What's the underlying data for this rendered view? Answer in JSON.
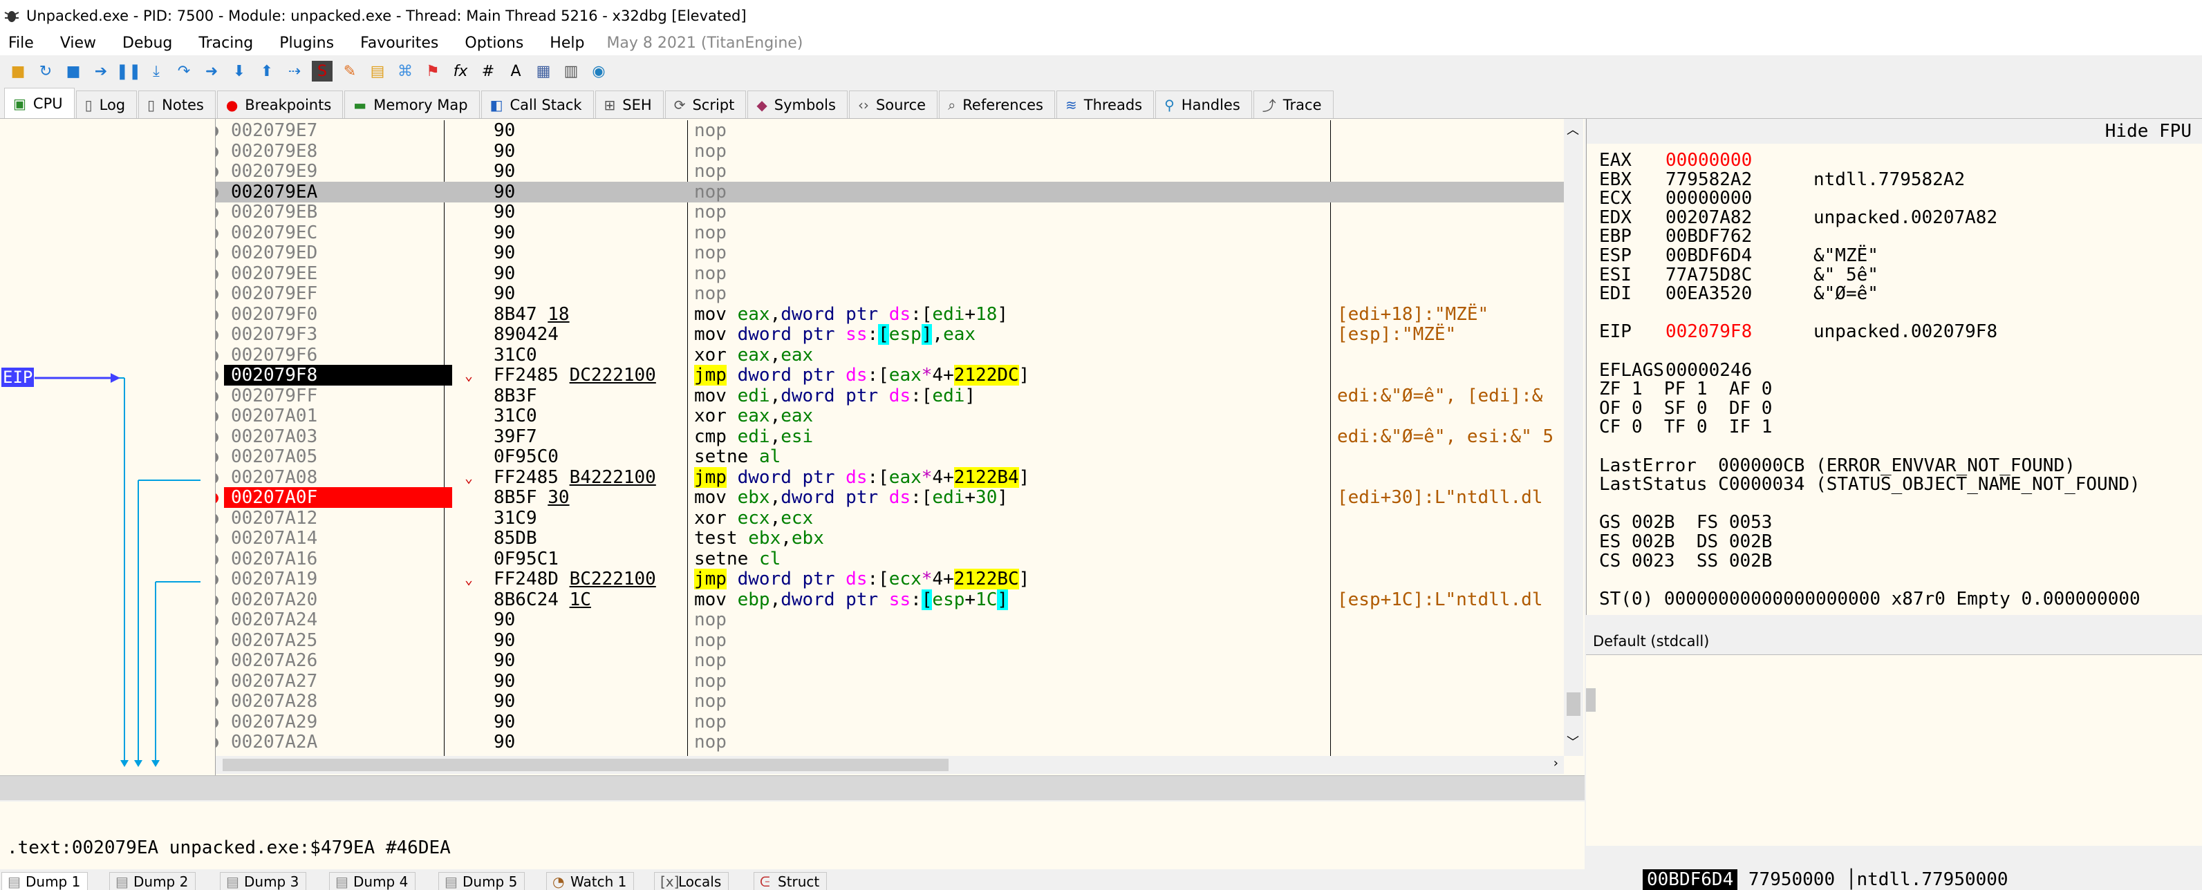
{
  "window": {
    "title": "Unpacked.exe - PID: 7500 - Module: unpacked.exe - Thread: Main Thread 5216 - x32dbg [Elevated]"
  },
  "menu": {
    "items": [
      "File",
      "View",
      "Debug",
      "Tracing",
      "Plugins",
      "Favourites",
      "Options",
      "Help"
    ],
    "date": "May 8 2021 (TitanEngine)"
  },
  "toolbar": {
    "icons": [
      "open-icon",
      "restart-icon",
      "stop-icon",
      "run-icon",
      "pause-icon",
      "step-into-icon",
      "step-over-icon",
      "trace-into-icon",
      "trace-over-icon",
      "execute-till-return-icon",
      "run-to-user-code-icon",
      "scylla-icon",
      "patch-icon",
      "comment-icon",
      "label-icon",
      "bookmark-icon",
      "function-icon",
      "hash-icon",
      "font-icon",
      "settings-icon",
      "calculator-icon",
      "globe-icon"
    ]
  },
  "tabs": [
    {
      "label": "CPU",
      "icon": "cpu-icon",
      "active": true
    },
    {
      "label": "Log",
      "icon": "log-icon"
    },
    {
      "label": "Notes",
      "icon": "notes-icon"
    },
    {
      "label": "Breakpoints",
      "icon": "breakpoint-icon"
    },
    {
      "label": "Memory Map",
      "icon": "memory-icon"
    },
    {
      "label": "Call Stack",
      "icon": "callstack-icon"
    },
    {
      "label": "SEH",
      "icon": "seh-icon"
    },
    {
      "label": "Script",
      "icon": "script-icon"
    },
    {
      "label": "Symbols",
      "icon": "symbols-icon"
    },
    {
      "label": "Source",
      "icon": "source-icon"
    },
    {
      "label": "References",
      "icon": "references-icon"
    },
    {
      "label": "Threads",
      "icon": "threads-icon"
    },
    {
      "label": "Handles",
      "icon": "handles-icon"
    },
    {
      "label": "Trace",
      "icon": "trace-icon"
    }
  ],
  "eip_label": "EIP",
  "disasm": [
    {
      "addr": "002079E7",
      "bytes": "90",
      "asm": "nop"
    },
    {
      "addr": "002079E8",
      "bytes": "90",
      "asm": "nop"
    },
    {
      "addr": "002079E9",
      "bytes": "90",
      "asm": "nop"
    },
    {
      "addr": "002079EA",
      "bytes": "90",
      "asm": "nop",
      "selected": true
    },
    {
      "addr": "002079EB",
      "bytes": "90",
      "asm": "nop"
    },
    {
      "addr": "002079EC",
      "bytes": "90",
      "asm": "nop"
    },
    {
      "addr": "002079ED",
      "bytes": "90",
      "asm": "nop"
    },
    {
      "addr": "002079EE",
      "bytes": "90",
      "asm": "nop"
    },
    {
      "addr": "002079EF",
      "bytes": "90",
      "asm": "nop"
    },
    {
      "addr": "002079F0",
      "bytes": "8B47 18",
      "asm": "mov eax,dword ptr ds:[edi+18]",
      "comment": "[edi+18]:\"MZË\""
    },
    {
      "addr": "002079F3",
      "bytes": "890424",
      "asm": "mov dword ptr ss:[esp],eax",
      "comment": "[esp]:\"MZË\""
    },
    {
      "addr": "002079F6",
      "bytes": "31C0",
      "asm": "xor eax,eax"
    },
    {
      "addr": "002079F8",
      "bytes": "FF2485 DC222100",
      "asm": "jmp dword ptr ds:[eax*4+2122DC]",
      "eip": true
    },
    {
      "addr": "002079FF",
      "bytes": "8B3F",
      "asm": "mov edi,dword ptr ds:[edi]",
      "comment": "edi:&\"Ø=ê\", [edi]:&"
    },
    {
      "addr": "00207A01",
      "bytes": "31C0",
      "asm": "xor eax,eax"
    },
    {
      "addr": "00207A03",
      "bytes": "39F7",
      "asm": "cmp edi,esi",
      "comment": "edi:&\"Ø=ê\", esi:&\" 5"
    },
    {
      "addr": "00207A05",
      "bytes": "0F95C0",
      "asm": "setne al"
    },
    {
      "addr": "00207A08",
      "bytes": "FF2485 B4222100",
      "asm": "jmp dword ptr ds:[eax*4+2122B4]"
    },
    {
      "addr": "00207A0F",
      "bytes": "8B5F 30",
      "asm": "mov ebx,dword ptr ds:[edi+30]",
      "comment": "[edi+30]:L\"ntdll.dl",
      "bp": true
    },
    {
      "addr": "00207A12",
      "bytes": "31C9",
      "asm": "xor ecx,ecx"
    },
    {
      "addr": "00207A14",
      "bytes": "85DB",
      "asm": "test ebx,ebx"
    },
    {
      "addr": "00207A16",
      "bytes": "0F95C1",
      "asm": "setne cl"
    },
    {
      "addr": "00207A19",
      "bytes": "FF248D BC222100",
      "asm": "jmp dword ptr ds:[ecx*4+2122BC]"
    },
    {
      "addr": "00207A20",
      "bytes": "8B6C24 1C",
      "asm": "mov ebp,dword ptr ss:[esp+1C]",
      "comment": "[esp+1C]:L\"ntdll.dl"
    },
    {
      "addr": "00207A24",
      "bytes": "90",
      "asm": "nop"
    },
    {
      "addr": "00207A25",
      "bytes": "90",
      "asm": "nop"
    },
    {
      "addr": "00207A26",
      "bytes": "90",
      "asm": "nop"
    },
    {
      "addr": "00207A27",
      "bytes": "90",
      "asm": "nop"
    },
    {
      "addr": "00207A28",
      "bytes": "90",
      "asm": "nop"
    },
    {
      "addr": "00207A29",
      "bytes": "90",
      "asm": "nop"
    },
    {
      "addr": "00207A2A",
      "bytes": "90",
      "asm": "nop"
    }
  ],
  "info_line": ".text:002079EA unpacked.exe:$479EA #46DEA",
  "registers": {
    "hide_fpu": "Hide FPU",
    "lines": [
      {
        "name": "EAX",
        "value": "00000000",
        "info": "",
        "changed": true
      },
      {
        "name": "EBX",
        "value": "779582A2",
        "info": "ntdll.779582A2"
      },
      {
        "name": "ECX",
        "value": "00000000",
        "info": ""
      },
      {
        "name": "EDX",
        "value": "00207A82",
        "info": "unpacked.00207A82"
      },
      {
        "name": "EBP",
        "value": "00BDF762",
        "info": ""
      },
      {
        "name": "ESP",
        "value": "00BDF6D4",
        "info": "&\"MZË\""
      },
      {
        "name": "ESI",
        "value": "77A75D8C",
        "info": "&\" 5ê\""
      },
      {
        "name": "EDI",
        "value": "00EA3520",
        "info": "&\"Ø=ê\""
      },
      {
        "name": "",
        "value": "",
        "info": ""
      },
      {
        "name": "EIP",
        "value": "002079F8",
        "info": "unpacked.002079F8",
        "changed": true
      },
      {
        "name": "",
        "value": "",
        "info": ""
      },
      {
        "name": "EFLAGS",
        "value": "00000246",
        "info": ""
      },
      {
        "name": "",
        "value": "",
        "info": "",
        "raw": "ZF 1  PF 1  AF 0"
      },
      {
        "name": "",
        "value": "",
        "info": "",
        "raw": "OF 0  SF 0  DF 0"
      },
      {
        "name": "",
        "value": "",
        "info": "",
        "raw": "CF 0  TF 0  IF 1"
      },
      {
        "name": "",
        "value": "",
        "info": "",
        "raw": ""
      },
      {
        "name": "",
        "value": "",
        "info": "",
        "raw": "LastError  000000CB (ERROR_ENVVAR_NOT_FOUND)"
      },
      {
        "name": "",
        "value": "",
        "info": "",
        "raw": "LastStatus C0000034 (STATUS_OBJECT_NAME_NOT_FOUND)"
      },
      {
        "name": "",
        "value": "",
        "info": "",
        "raw": ""
      },
      {
        "name": "",
        "value": "",
        "info": "",
        "raw": "GS 002B  FS 0053"
      },
      {
        "name": "",
        "value": "",
        "info": "",
        "raw": "ES 002B  DS 002B"
      },
      {
        "name": "",
        "value": "",
        "info": "",
        "raw": "CS 0023  SS 002B"
      },
      {
        "name": "",
        "value": "",
        "info": "",
        "raw": ""
      },
      {
        "name": "",
        "value": "",
        "info": "",
        "raw": "ST(0) 00000000000000000000 x87r0 Empty 0.000000000"
      }
    ]
  },
  "callconv": "Default (stdcall)",
  "bottom_tabs": [
    {
      "label": "Dump 1",
      "active": true
    },
    {
      "label": "Dump 2"
    },
    {
      "label": "Dump 3"
    },
    {
      "label": "Dump 4"
    },
    {
      "label": "Dump 5"
    },
    {
      "label": "Watch 1"
    },
    {
      "label": "Locals"
    },
    {
      "label": "Struct"
    }
  ],
  "stack_line": {
    "addr": "00BDF6D4",
    "value": "77950000",
    "info": "ntdll.77950000"
  }
}
